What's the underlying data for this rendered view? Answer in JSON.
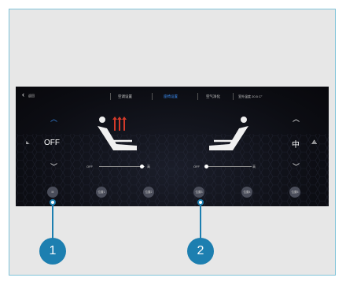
{
  "header": {
    "back_label": "返回",
    "tabs": [
      {
        "label": "空调设置",
        "active": false
      },
      {
        "label": "座椅设置",
        "active": true
      },
      {
        "label": "空气净化",
        "active": false
      }
    ],
    "outside_temp": "室外温度 20.5 C°"
  },
  "left_seat": {
    "mode": "OFF",
    "slider_min": "OFF",
    "slider_max": "高"
  },
  "right_seat": {
    "mode": "中",
    "slider_min": "OFF",
    "slider_max": "高"
  },
  "positions": [
    {
      "label": "M"
    },
    {
      "label": "位置1"
    },
    {
      "label": "位置2"
    },
    {
      "label": "位置3"
    },
    {
      "label": "位置4"
    },
    {
      "label": "位置5"
    }
  ],
  "callouts": [
    {
      "number": "1"
    },
    {
      "number": "2"
    }
  ],
  "colors": {
    "accent": "#3b8cf0",
    "heat": "#d23a2a",
    "callout": "#1d7fb0",
    "frame_border": "#7fc3d8"
  }
}
